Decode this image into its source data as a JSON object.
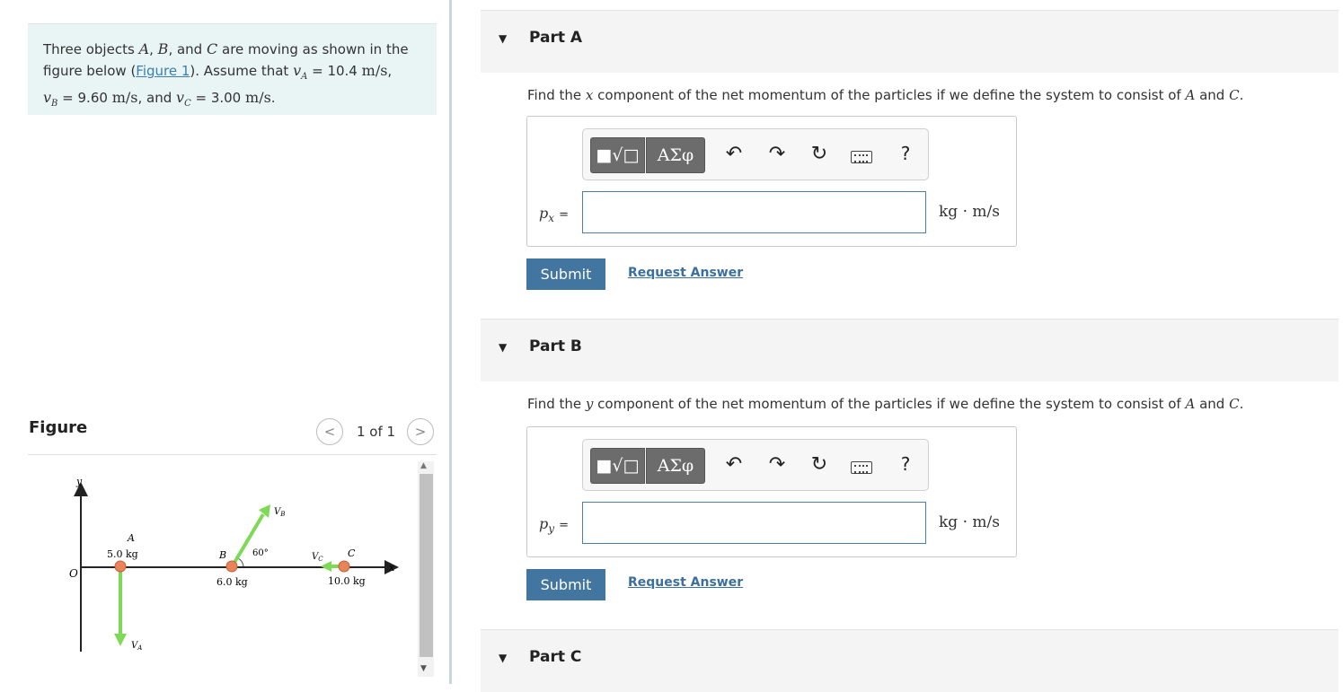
{
  "problem": {
    "text_intro": "Three objects",
    "obj_a": "A",
    "obj_b": "B",
    "obj_c": "C",
    "text_and": "and",
    "text_moving": "are moving as shown in the figure below (",
    "figure_link": "Figure 1",
    "text_assume": "). Assume that",
    "va_sym": "v",
    "va_sub": "A",
    "va_value": "10.4",
    "vb_sym": "v",
    "vb_sub": "B",
    "vb_value": "9.60",
    "vc_sym": "v",
    "vc_sub": "C",
    "vc_value": "3.00",
    "unit": "m/s"
  },
  "figure_panel": {
    "title": "Figure",
    "counter": "1 of 1",
    "prev_icon": "chevron-left-icon",
    "next_icon": "chevron-right-icon",
    "diagram": {
      "y_axis": "y",
      "x_axis": "x",
      "origin": "O",
      "a_label": "A",
      "a_mass": "5.0 kg",
      "va_label": "V",
      "va_sub": "A",
      "b_label": "B",
      "b_mass": "6.0 kg",
      "vb_label": "V",
      "vb_sub": "B",
      "angle": "60°",
      "c_label": "C",
      "c_mass": "10.0 kg",
      "vc_label": "V",
      "vc_sub": "C"
    }
  },
  "parts": [
    {
      "title": "Part A",
      "q_prefix": "Find the",
      "q_var": "x",
      "q_middle": "component of the net momentum of the particles if we define the system to consist of",
      "q_a": "A",
      "q_and": "and",
      "q_c": "C",
      "q_end": ".",
      "var_sym": "p",
      "var_sub": "x",
      "var_eq": "=",
      "input_value": "",
      "units": "kg · m/s",
      "submit": "Submit",
      "request": "Request Answer",
      "toolbar": {
        "templates": "■√□",
        "greek": "ΑΣφ",
        "undo": "↶",
        "redo": "↷",
        "reset": "↻",
        "help": "?"
      }
    },
    {
      "title": "Part B",
      "q_prefix": "Find the",
      "q_var": "y",
      "q_middle": "component of the net momentum of the particles if we define the system to consist of",
      "q_a": "A",
      "q_and": "and",
      "q_c": "C",
      "q_end": ".",
      "var_sym": "p",
      "var_sub": "y",
      "var_eq": "=",
      "input_value": "",
      "units": "kg · m/s",
      "submit": "Submit",
      "request": "Request Answer",
      "toolbar": {
        "templates": "■√□",
        "greek": "ΑΣφ",
        "undo": "↶",
        "redo": "↷",
        "reset": "↻",
        "help": "?"
      }
    },
    {
      "title": "Part C"
    }
  ],
  "colors": {
    "problem_bg": "#e9f4f4",
    "submit_bg": "#4276a0",
    "arrow_green": "#7ed957",
    "particle_orange": "#e8835a"
  }
}
